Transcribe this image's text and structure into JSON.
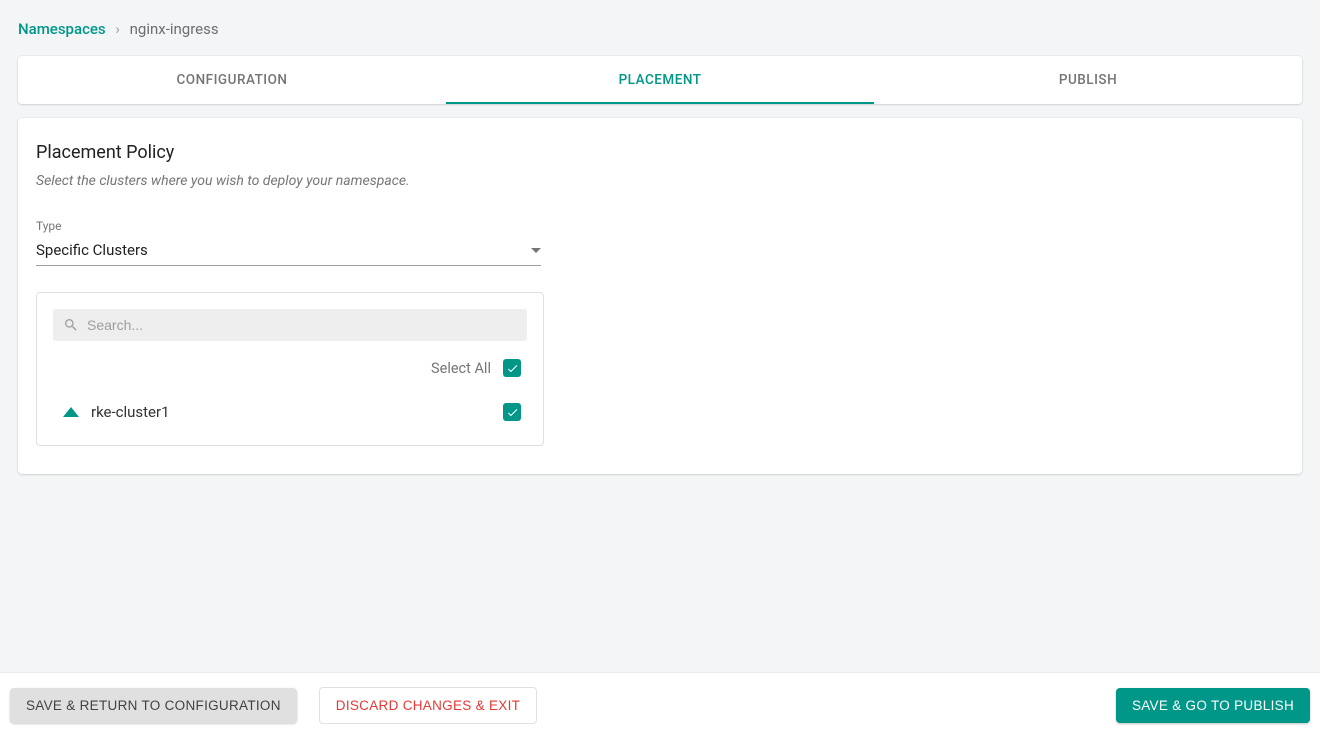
{
  "breadcrumb": {
    "root": "Namespaces",
    "separator": "›",
    "current": "nginx-ingress"
  },
  "tabs": {
    "configuration": "CONFIGURATION",
    "placement": "PLACEMENT",
    "publish": "PUBLISH"
  },
  "placement": {
    "title": "Placement Policy",
    "description": "Select the clusters where you wish to deploy your namespace.",
    "type_label": "Type",
    "type_value": "Specific Clusters",
    "search_placeholder": "Search...",
    "select_all_label": "Select All",
    "select_all_checked": true,
    "clusters": [
      {
        "name": "rke-cluster1",
        "checked": true
      }
    ]
  },
  "footer": {
    "save_return": "SAVE & RETURN TO CONFIGURATION",
    "discard": "DISCARD CHANGES & EXIT",
    "save_publish": "SAVE & GO TO PUBLISH"
  }
}
